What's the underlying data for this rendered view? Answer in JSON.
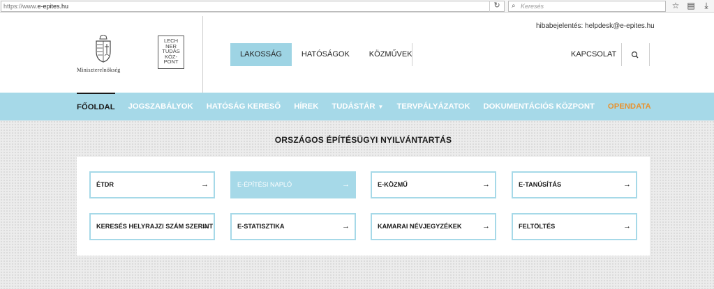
{
  "browser": {
    "url_prefix": "https://www.",
    "url_domain": "e-epites.hu",
    "reload_icon": "reload-icon",
    "search_placeholder": "Keresés"
  },
  "header": {
    "ministry": "Miniszterelnökség",
    "lechner_logo": "LECH NER TUDÁS KÖZ- PONT",
    "helpdesk": "hibabejelentés: helpdesk@e-epites.hu",
    "tabs": [
      "LAKOSSÁG",
      "HATÓSÁGOK",
      "KÖZMŰVEK"
    ],
    "active_tab": "LAKOSSÁG",
    "contact": "KAPCSOLAT"
  },
  "mainnav": {
    "items": [
      "FŐOLDAL",
      "JOGSZABÁLYOK",
      "HATÓSÁG KERESŐ",
      "HÍREK",
      "TUDÁSTÁR",
      "TERVPÁLYÁZATOK",
      "DOKUMENTÁCIÓS KÖZPONT",
      "OPENDATA"
    ],
    "current": "FŐOLDAL"
  },
  "section": {
    "title": "ORSZÁGOS ÉPÍTÉSÜGYI NYILVÁNTARTÁS",
    "tiles": [
      "ÉTDR",
      "E-ÉPÍTÉSI NAPLÓ",
      "E-KÖZMŰ",
      "E-TANÚSÍTÁS",
      "KERESÉS HELYRAJZI SZÁM SZERINT",
      "E-STATISZTIKA",
      "KAMARAI NÉVJEGYZÉKEK",
      "FELTÖLTÉS"
    ],
    "active_tile": "E-ÉPÍTÉSI NAPLÓ"
  },
  "colors": {
    "accent": "#a6d9e8",
    "orange": "#e8922e",
    "text": "#1a1a1a"
  }
}
